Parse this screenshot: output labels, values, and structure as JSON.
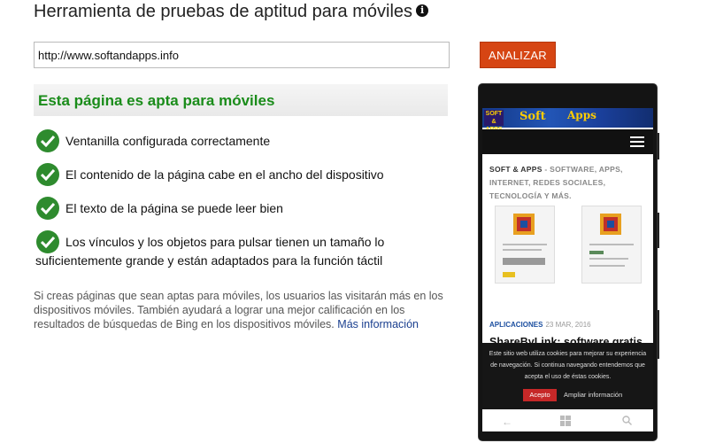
{
  "header": {
    "title": "Herramienta de pruebas de aptitud para móviles",
    "info_icon": "i"
  },
  "form": {
    "url_value": "http://www.softandapps.info",
    "analyze_label": "ANALIZAR"
  },
  "result": {
    "banner": "Esta página es apta para móviles",
    "checks": [
      "Ventanilla configurada correctamente",
      "El contenido de la página cabe en el ancho del dispositivo",
      "El texto de la página se puede leer bien",
      "Los vínculos y los objetos para pulsar tienen un tamaño lo",
      "suficientemente grande y están adaptados para la función táctil"
    ],
    "description": "Si creas páginas que sean aptas para móviles, los usuarios las visitarán más en los dispositivos móviles. También ayudará a lograr una mejor calificación en los resultados de búsquedas de Bing en los dispositivos móviles.",
    "more_link": "Más información"
  },
  "phone": {
    "logo": "SOFT & APPS",
    "banner_word_1": "Soft",
    "banner_word_2": "Apps",
    "site_description_bold": "SOFT & APPS",
    "site_description": "- SOFTWARE, APPS, INTERNET, REDES SOCIALES, TECNOLOGÍA Y MÁS.",
    "post_category": "APLICACIONES",
    "post_date": "23 MAR, 2016",
    "post_title": "ShareByLink: software gratis para enviar archivos de gran",
    "cookie_text": "Este sitio web utiliza cookies para mejorar su experiencia de navegación. Si continua navegando entendemos que acepta el uso de éstas cookies.",
    "accept_label": "Acepto",
    "more_info_label": "Ampliar información",
    "nav_icons": [
      "back-arrow-icon",
      "windows-logo-icon",
      "search-icon"
    ]
  },
  "colors": {
    "analyze_button": "#d64513",
    "pass_green": "#1a8c1a",
    "link_blue": "#1a3f8f"
  }
}
